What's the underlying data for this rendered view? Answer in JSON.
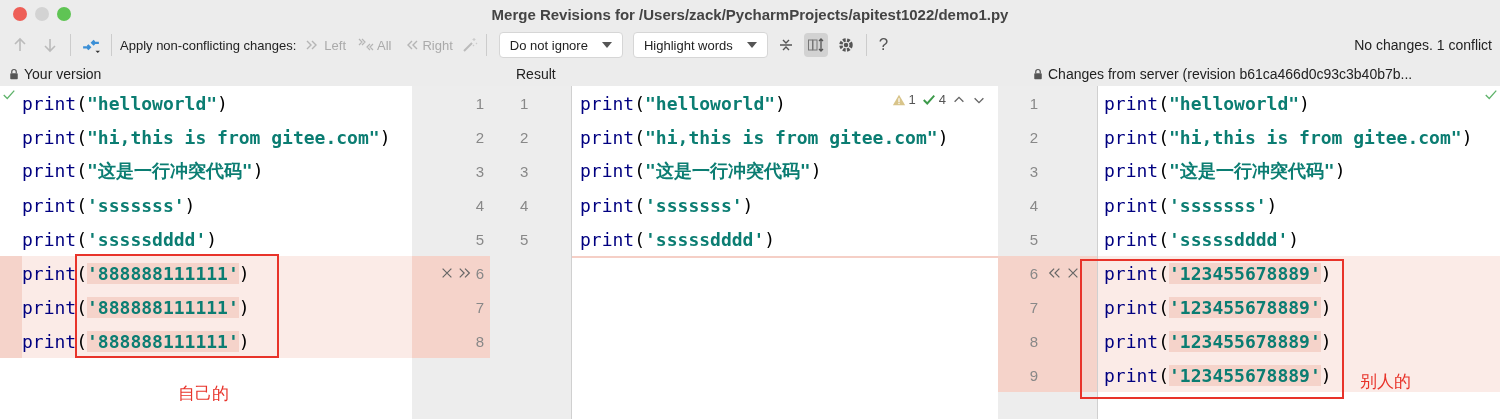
{
  "window": {
    "title": "Merge Revisions for /Users/zack/PycharmProjects/apitest1022/demo1.py"
  },
  "toolbar": {
    "apply_label": "Apply non-conflicting changes:",
    "apply_buttons": [
      {
        "kind": "left",
        "label": "Left",
        "disabled": true
      },
      {
        "kind": "all",
        "label": "All",
        "disabled": true
      },
      {
        "kind": "right",
        "label": "Right",
        "disabled": true
      }
    ],
    "dropdowns": [
      {
        "value": "Do not ignore"
      },
      {
        "value": "Highlight words"
      }
    ],
    "sync_scroll_selected": true,
    "help": "?",
    "status": "No changes. 1 conflict"
  },
  "panes": [
    {
      "kind": "yours",
      "title": "Your version",
      "locked": true,
      "annotation": {
        "label": "自己的"
      },
      "lines": [
        {
          "tokens": [
            "print",
            "(",
            "\"helloworld\"",
            ")"
          ],
          "conflict": false
        },
        {
          "tokens": [
            "print",
            "(",
            "\"hi,this is from gitee.com\"",
            ")"
          ],
          "conflict": false
        },
        {
          "tokens": [
            "print",
            "(",
            "\"这是一行冲突代码\"",
            ")"
          ],
          "conflict": false
        },
        {
          "tokens": [
            "print",
            "(",
            "'sssssss'",
            ")"
          ],
          "conflict": false
        },
        {
          "tokens": [
            "print",
            "(",
            "'sssssdddd'",
            ")"
          ],
          "conflict": false
        },
        {
          "tokens": [
            "print",
            "(",
            "'888888111111'",
            ")"
          ],
          "conflict": true
        },
        {
          "tokens": [
            "print",
            "(",
            "'888888111111'",
            ")"
          ],
          "conflict": true
        },
        {
          "tokens": [
            "print",
            "(",
            "'888888111111'",
            ")"
          ],
          "conflict": true
        }
      ]
    },
    {
      "kind": "result",
      "title": "Result",
      "locked": false,
      "inspections": {
        "warnings": "1",
        "checks": "4"
      },
      "lines": [
        {
          "tokens": [
            "print",
            "(",
            "\"helloworld\"",
            ")"
          ],
          "conflict": false
        },
        {
          "tokens": [
            "print",
            "(",
            "\"hi,this is from gitee.com\"",
            ")"
          ],
          "conflict": false
        },
        {
          "tokens": [
            "print",
            "(",
            "\"这是一行冲突代码\"",
            ")"
          ],
          "conflict": false
        },
        {
          "tokens": [
            "print",
            "(",
            "'sssssss'",
            ")"
          ],
          "conflict": false
        },
        {
          "tokens": [
            "print",
            "(",
            "'sssssdddd'",
            ")"
          ],
          "conflict": false
        }
      ]
    },
    {
      "kind": "server",
      "title": "Changes from server (revision b61ca466d0c93c3b40b7b...",
      "locked": true,
      "annotation": {
        "label": "别人的"
      },
      "lines": [
        {
          "tokens": [
            "print",
            "(",
            "\"helloworld\"",
            ")"
          ],
          "conflict": false
        },
        {
          "tokens": [
            "print",
            "(",
            "\"hi,this is from gitee.com\"",
            ")"
          ],
          "conflict": false
        },
        {
          "tokens": [
            "print",
            "(",
            "\"这是一行冲突代码\"",
            ")"
          ],
          "conflict": false
        },
        {
          "tokens": [
            "print",
            "(",
            "'sssssss'",
            ")"
          ],
          "conflict": false
        },
        {
          "tokens": [
            "print",
            "(",
            "'sssssdddd'",
            ")"
          ],
          "conflict": false
        },
        {
          "tokens": [
            "print",
            "(",
            "'123455678889'",
            ")"
          ],
          "conflict": true
        },
        {
          "tokens": [
            "print",
            "(",
            "'123455678889'",
            ")"
          ],
          "conflict": true
        },
        {
          "tokens": [
            "print",
            "(",
            "'123455678889'",
            ")"
          ],
          "conflict": true
        },
        {
          "tokens": [
            "print",
            "(",
            "'123455678889'",
            ")"
          ],
          "conflict": true
        }
      ]
    }
  ],
  "gutters": [
    {
      "left_numbers": [
        "1",
        "2",
        "3",
        "4",
        "5",
        "6",
        "7",
        "8"
      ],
      "result_numbers": [
        "1",
        "2",
        "3",
        "4",
        "5"
      ]
    },
    {
      "numbers": [
        "1",
        "2",
        "3",
        "4",
        "5",
        "6",
        "7",
        "8",
        "9"
      ]
    }
  ]
}
